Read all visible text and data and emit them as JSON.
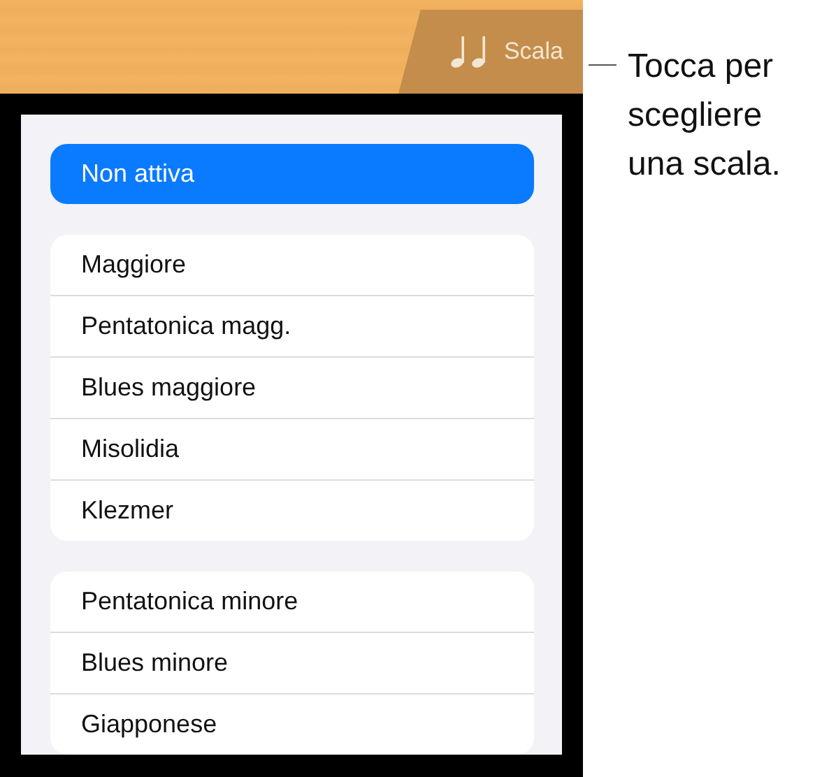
{
  "toolbar": {
    "scale_button": {
      "label": "Scala"
    }
  },
  "callout": {
    "text": "Tocca per scegliere una scala."
  },
  "scale_groups": [
    {
      "items": [
        {
          "label": "Non attiva",
          "selected": true
        }
      ]
    },
    {
      "items": [
        {
          "label": "Maggiore",
          "selected": false
        },
        {
          "label": "Pentatonica magg.",
          "selected": false
        },
        {
          "label": "Blues maggiore",
          "selected": false
        },
        {
          "label": "Misolidia",
          "selected": false
        },
        {
          "label": "Klezmer",
          "selected": false
        }
      ]
    },
    {
      "items": [
        {
          "label": "Pentatonica minore",
          "selected": false
        },
        {
          "label": "Blues minore",
          "selected": false
        },
        {
          "label": "Giapponese",
          "selected": false
        }
      ]
    }
  ]
}
